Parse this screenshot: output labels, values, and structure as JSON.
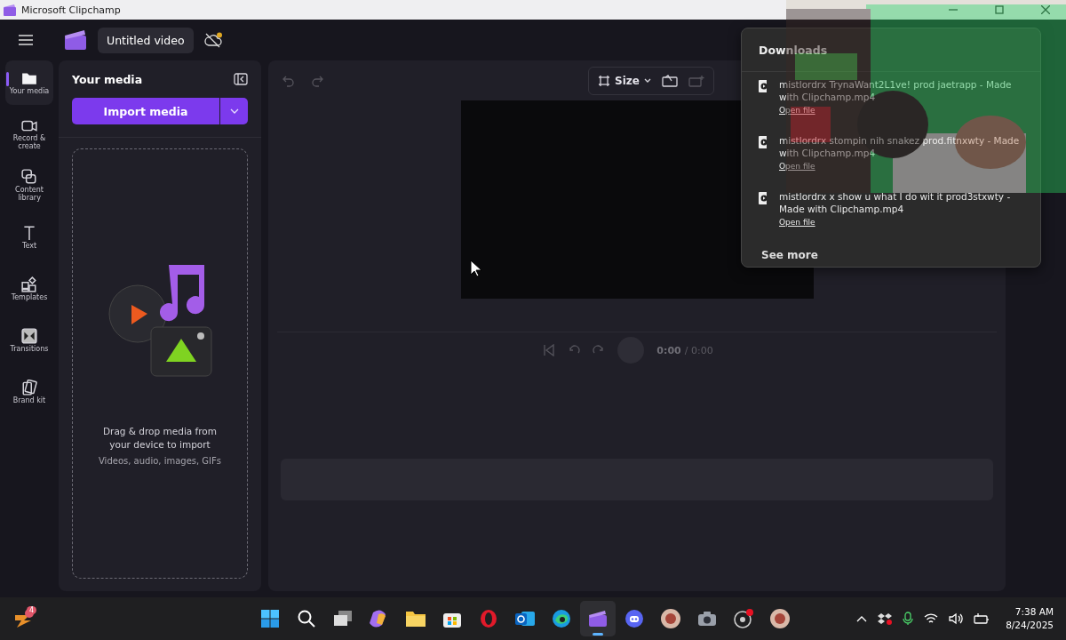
{
  "window": {
    "title": "Microsoft Clipchamp"
  },
  "header": {
    "project_title": "Untitled video"
  },
  "rail": {
    "items": [
      {
        "kind": "folder",
        "label": "Your media",
        "selected": true
      },
      {
        "kind": "camera",
        "label": "Record & create",
        "selected": false
      },
      {
        "kind": "library",
        "label": "Content library",
        "selected": false
      },
      {
        "kind": "text",
        "label": "Text",
        "selected": false
      },
      {
        "kind": "templates",
        "label": "Templates",
        "selected": false
      },
      {
        "kind": "transitions",
        "label": "Transitions",
        "selected": false
      },
      {
        "kind": "brand",
        "label": "Brand kit",
        "selected": false
      }
    ]
  },
  "media_panel": {
    "title": "Your media",
    "import_button": "Import media",
    "drop_hint": "Drag & drop media from your device to import",
    "types_hint": "Videos, audio, images, GIFs"
  },
  "preview": {
    "size_button": "Size",
    "time_current": "0:00",
    "time_total": "/ 0:00"
  },
  "downloads": {
    "title": "Downloads",
    "items": [
      {
        "name": "mistlordrx TrynaWant2L1ve! prod jaetrapp - Made with Clipchamp.mp4",
        "action": "Open file"
      },
      {
        "name": "mistlordrx stompin nih snakez prod.fitnxwty - Made with Clipchamp.mp4",
        "action": "Open file"
      },
      {
        "name": "mistlordrx x show u what I do wit it prod3stxwty - Made with Clipchamp.mp4",
        "action": "Open file"
      }
    ],
    "see_more": "See more"
  },
  "taskbar": {
    "badge": "4",
    "apps": [
      {
        "kind": "windows",
        "selected": false
      },
      {
        "kind": "search",
        "selected": false
      },
      {
        "kind": "taskview",
        "selected": false
      },
      {
        "kind": "copilot",
        "selected": false
      },
      {
        "kind": "explorer",
        "selected": false
      },
      {
        "kind": "store",
        "selected": false
      },
      {
        "kind": "opera",
        "selected": false
      },
      {
        "kind": "outlook",
        "selected": false
      },
      {
        "kind": "edge",
        "selected": false
      },
      {
        "kind": "clipchamp",
        "selected": true
      },
      {
        "kind": "discord",
        "selected": false
      },
      {
        "kind": "avatar",
        "selected": false
      },
      {
        "kind": "camera",
        "selected": false
      },
      {
        "kind": "obs",
        "selected": false
      },
      {
        "kind": "avatar",
        "selected": false
      }
    ],
    "time": "7:38 AM",
    "date": "8/24/2025"
  }
}
